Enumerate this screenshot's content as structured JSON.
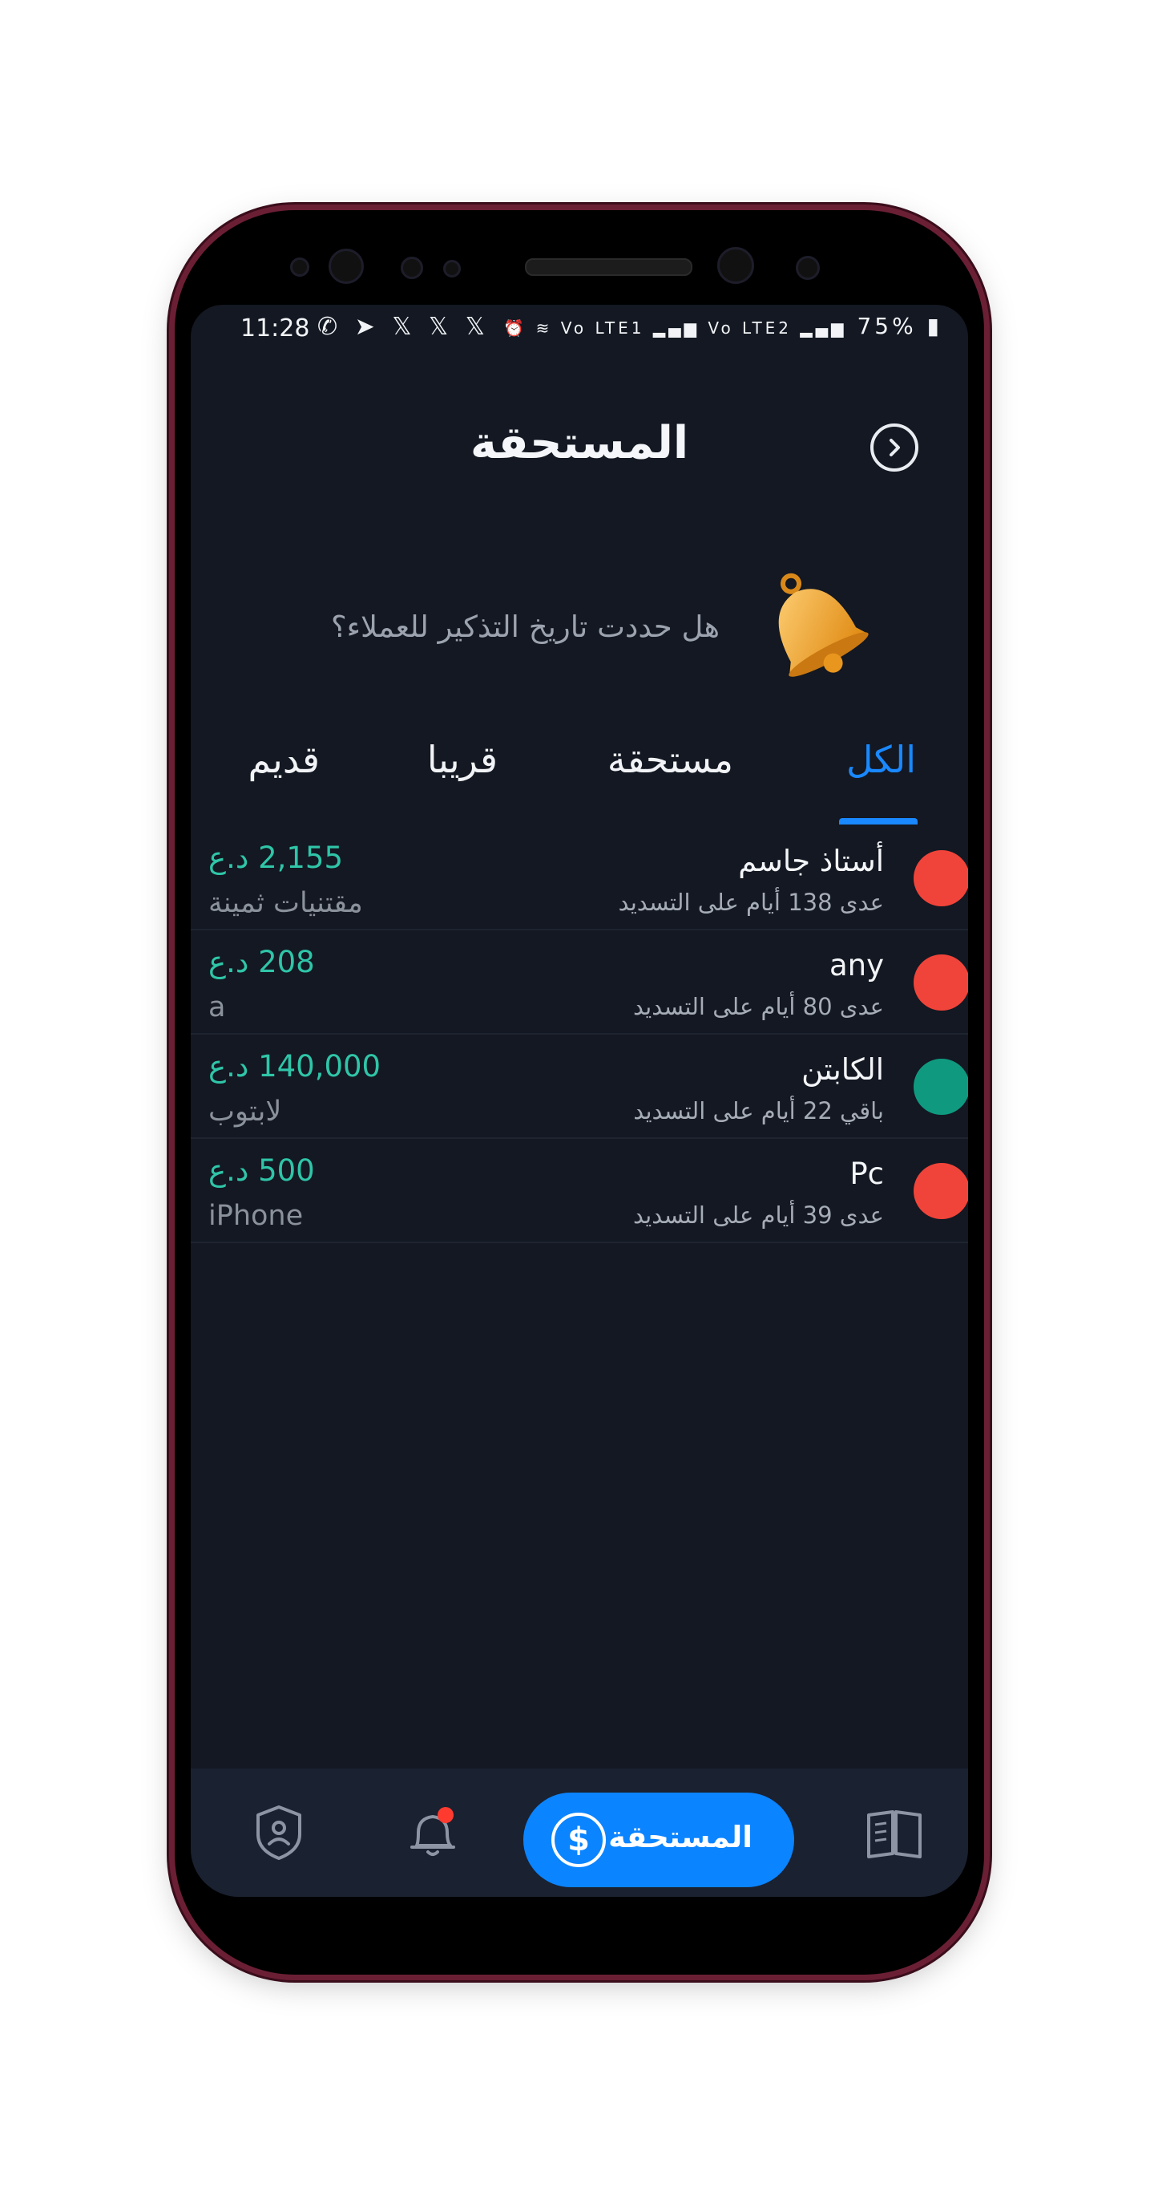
{
  "status_bar": {
    "time": "11:28",
    "left_icons": "✆ ➤ 𝕏 𝕏 𝕏 •",
    "battery": "75%",
    "right_icons": "⏰ ≋ Vo LTE1 ▂▄▆ Vo LTE2 ▂▄▆"
  },
  "header": {
    "title": "المستحقة",
    "back_icon": "chevron-right-circle-icon"
  },
  "reminder": {
    "text": "هل حددت تاريخ التذكير للعملاء؟",
    "icon": "bell-emoji-icon"
  },
  "tabs": [
    {
      "label": "الكل",
      "active": true
    },
    {
      "label": "مستحقة",
      "active": false
    },
    {
      "label": "قريبا",
      "active": false
    },
    {
      "label": "قديم",
      "active": false
    }
  ],
  "rows": [
    {
      "name": "أستاذ جاسم",
      "days": "عدى 138 أيام على التسديد",
      "amount": "2,155 د.ع",
      "desc": "مقتنيات ثمينة",
      "dot_color": "#f0443a"
    },
    {
      "name": "any",
      "days": "عدى 80 أيام على التسديد",
      "amount": "208 د.ع",
      "desc": "a",
      "dot_color": "#f0443a"
    },
    {
      "name": "الكابتن",
      "days": "باقي 22 أيام على التسديد",
      "amount": "140,000 د.ع",
      "desc": "لابتوب",
      "dot_color": "#0f9a80"
    },
    {
      "name": "Pc",
      "days": "عدى 39 أيام على التسديد",
      "amount": "500 د.ع",
      "desc": "iPhone",
      "dot_color": "#f0443a"
    }
  ],
  "bottom_nav": {
    "cta_label": "المستحقة",
    "cta_icon": "dollar-circle-icon",
    "items": [
      "guide-book-icon",
      "bell-icon",
      "profile-icon"
    ]
  },
  "colors": {
    "background": "#131822",
    "accent": "#1a88ff",
    "amount": "#2fc5a8",
    "overdue": "#f0443a",
    "upcoming": "#0f9a80"
  }
}
